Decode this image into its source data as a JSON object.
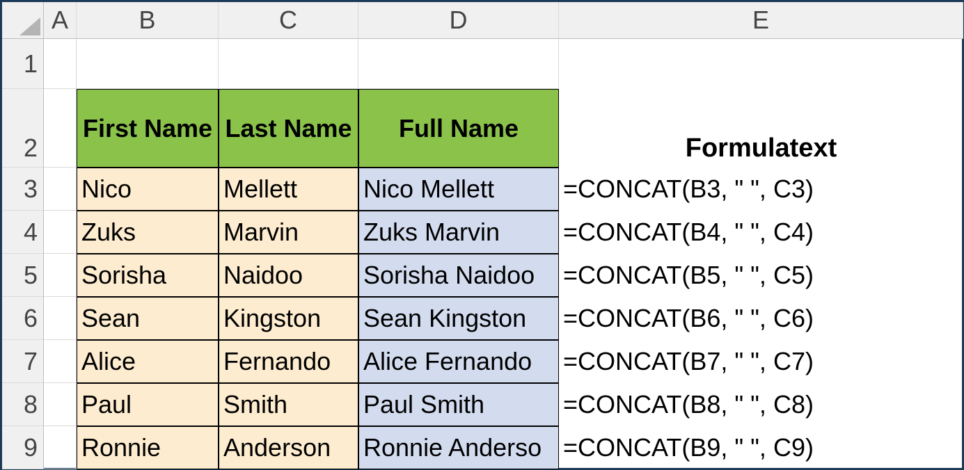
{
  "columns": [
    "A",
    "B",
    "C",
    "D",
    "E"
  ],
  "rows": [
    "1",
    "2",
    "3",
    "4",
    "5",
    "6",
    "7",
    "8",
    "9"
  ],
  "headers": {
    "firstName": "First Name",
    "lastName": "Last Name",
    "fullName": "Full Name",
    "formulaText": "Formulatext"
  },
  "data": [
    {
      "first": "Nico",
      "last": "Mellett",
      "full": "Nico Mellett",
      "formula": "=CONCAT(B3, \" \", C3)"
    },
    {
      "first": "Zuks",
      "last": "Marvin",
      "full": "Zuks Marvin",
      "formula": "=CONCAT(B4, \" \", C4)"
    },
    {
      "first": "Sorisha",
      "last": "Naidoo",
      "full": "Sorisha Naidoo",
      "formula": "=CONCAT(B5, \" \", C5)"
    },
    {
      "first": "Sean",
      "last": "Kingston",
      "full": "Sean Kingston",
      "formula": "=CONCAT(B6, \" \", C6)"
    },
    {
      "first": "Alice",
      "last": "Fernando",
      "full": "Alice Fernando",
      "formula": "=CONCAT(B7, \" \", C7)"
    },
    {
      "first": "Paul",
      "last": "Smith",
      "full": "Paul Smith",
      "formula": "=CONCAT(B8, \" \", C8)"
    },
    {
      "first": "Ronnie",
      "last": "Anderson",
      "full": "Ronnie  Anderso",
      "formula": "=CONCAT(B9, \" \", C9)"
    }
  ],
  "chart_data": {
    "type": "table",
    "title": "CONCAT formula example",
    "columns": [
      "First Name",
      "Last Name",
      "Full Name",
      "Formulatext"
    ],
    "rows": [
      [
        "Nico",
        "Mellett",
        "Nico Mellett",
        "=CONCAT(B3, \" \", C3)"
      ],
      [
        "Zuks",
        "Marvin",
        "Zuks Marvin",
        "=CONCAT(B4, \" \", C4)"
      ],
      [
        "Sorisha",
        "Naidoo",
        "Sorisha Naidoo",
        "=CONCAT(B5, \" \", C5)"
      ],
      [
        "Sean",
        "Kingston",
        "Sean Kingston",
        "=CONCAT(B6, \" \", C6)"
      ],
      [
        "Alice",
        "Fernando",
        "Alice Fernando",
        "=CONCAT(B7, \" \", C7)"
      ],
      [
        "Paul",
        "Smith",
        "Paul Smith",
        "=CONCAT(B8, \" \", C8)"
      ],
      [
        "Ronnie",
        "Anderson",
        "Ronnie  Anderso",
        "=CONCAT(B9, \" \", C9)"
      ]
    ]
  }
}
